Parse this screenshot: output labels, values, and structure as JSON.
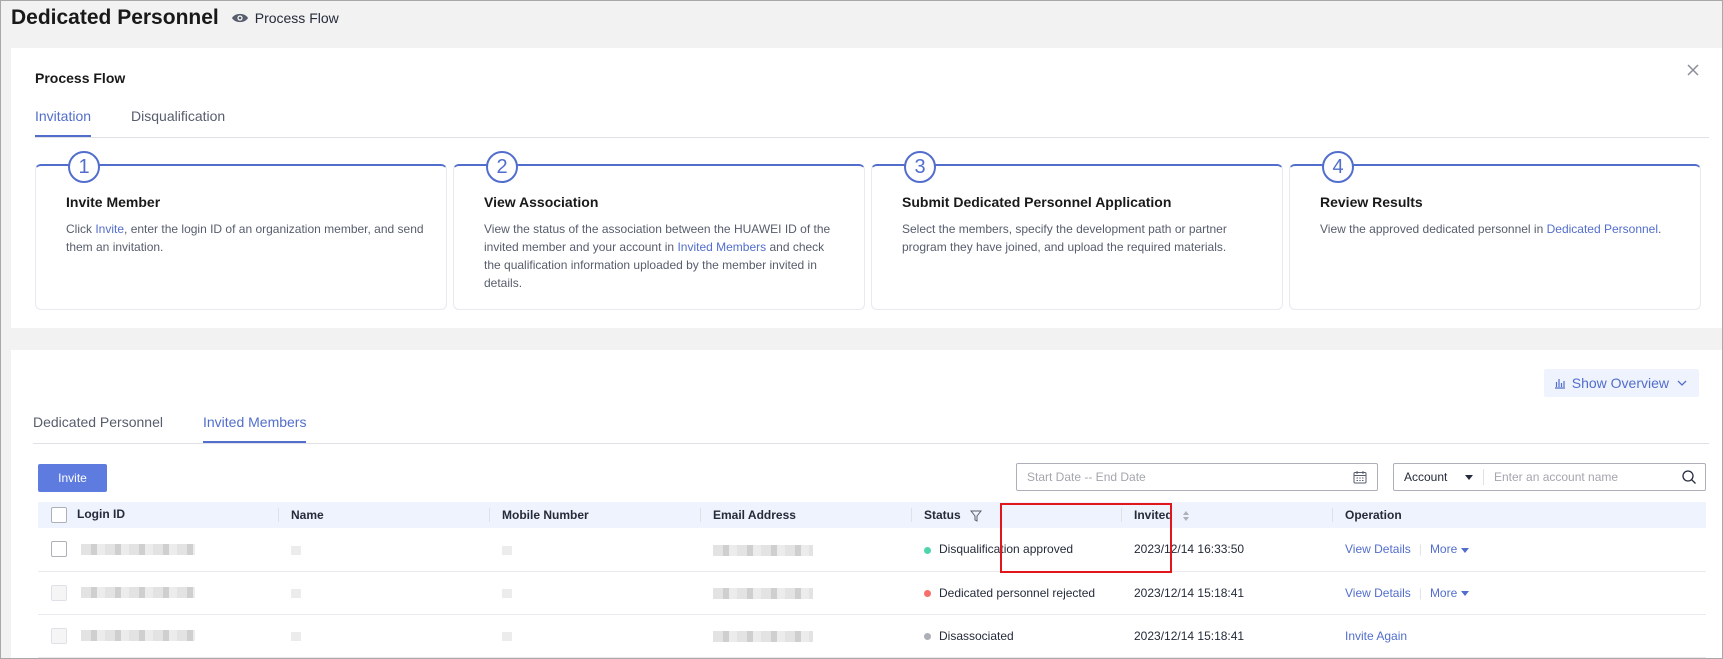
{
  "header": {
    "title": "Dedicated Personnel",
    "process_link": "Process Flow"
  },
  "process_flow": {
    "title": "Process Flow",
    "tabs": [
      {
        "label": "Invitation",
        "active": true
      },
      {
        "label": "Disqualification",
        "active": false
      }
    ],
    "steps": [
      {
        "num": "1",
        "title": "Invite Member",
        "desc_pre": "Click ",
        "desc_link": "Invite",
        "desc_post": ", enter the login ID of an organization member, and send them an invitation."
      },
      {
        "num": "2",
        "title": "View Association",
        "desc_pre": "View the status of the association between the HUAWEI ID of the invited member and your account in ",
        "desc_link": "Invited Members",
        "desc_post": " and check the qualification information uploaded by the member invited in details."
      },
      {
        "num": "3",
        "title": "Submit Dedicated Personnel Application",
        "desc_pre": "Select the members, specify the development path or partner program they have joined, and upload the required materials.",
        "desc_link": "",
        "desc_post": ""
      },
      {
        "num": "4",
        "title": "Review Results",
        "desc_pre": "View the approved dedicated personnel in ",
        "desc_link": "Dedicated Personnel",
        "desc_post": "."
      }
    ]
  },
  "main": {
    "overview_label": "Show Overview",
    "tabs": [
      {
        "label": "Dedicated Personnel",
        "active": false
      },
      {
        "label": "Invited Members",
        "active": true
      }
    ],
    "invite_label": "Invite",
    "date_placeholder": "Start Date -- End Date",
    "account_select": "Account",
    "account_placeholder": "Enter an account name",
    "columns": [
      "Login ID",
      "Name",
      "Mobile Number",
      "Email Address",
      "Status",
      "Invited",
      "Operation"
    ],
    "rows": [
      {
        "status": "Disqualification approved",
        "status_color": "#50d4ab",
        "invited": "2023/12/14 16:33:50",
        "op1": "View Details",
        "op2": "More"
      },
      {
        "status": "Dedicated personnel rejected",
        "status_color": "#f66f6a",
        "invited": "2023/12/14 15:18:41",
        "op1": "View Details",
        "op2": "More"
      },
      {
        "status": "Disassociated",
        "status_color": "#adb0b8",
        "invited": "2023/12/14 15:18:41",
        "op1": "Invite Again",
        "op2": ""
      }
    ]
  },
  "colors": {
    "accent": "#526ecc",
    "highlight": "#e0161a"
  }
}
